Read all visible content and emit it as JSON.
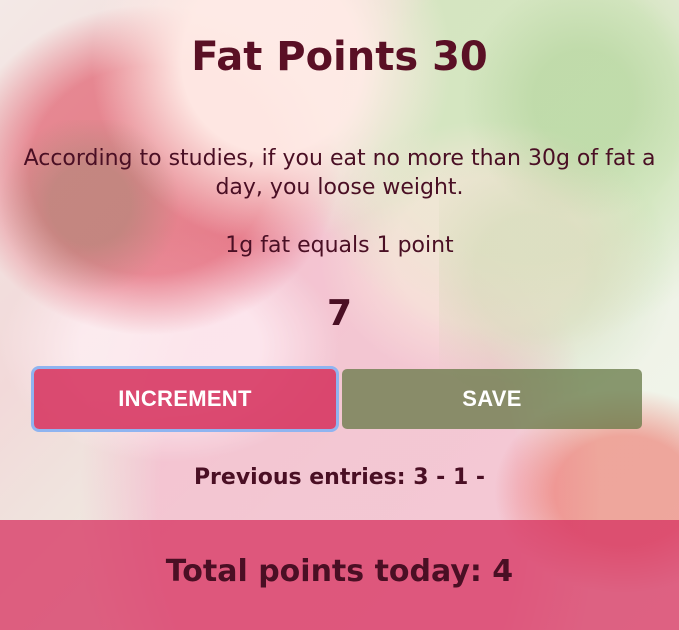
{
  "app": {
    "title": "Fat Points 30",
    "description": "According to studies, if you eat no more than 30g of fat a day, you loose weight.",
    "rule": "1g fat equals 1 point"
  },
  "counter": {
    "value": "7"
  },
  "buttons": {
    "increment_label": "INCREMENT",
    "save_label": "SAVE"
  },
  "entries": {
    "text": "Previous entries: 3 - 1 -"
  },
  "footer": {
    "total_text": "Total points today: 4"
  },
  "colors": {
    "title": "#5a1025",
    "increment_button": "#d63460",
    "save_button": "#667846",
    "footer_bar": "#d73764",
    "focus_ring": "#8fb4f0"
  }
}
